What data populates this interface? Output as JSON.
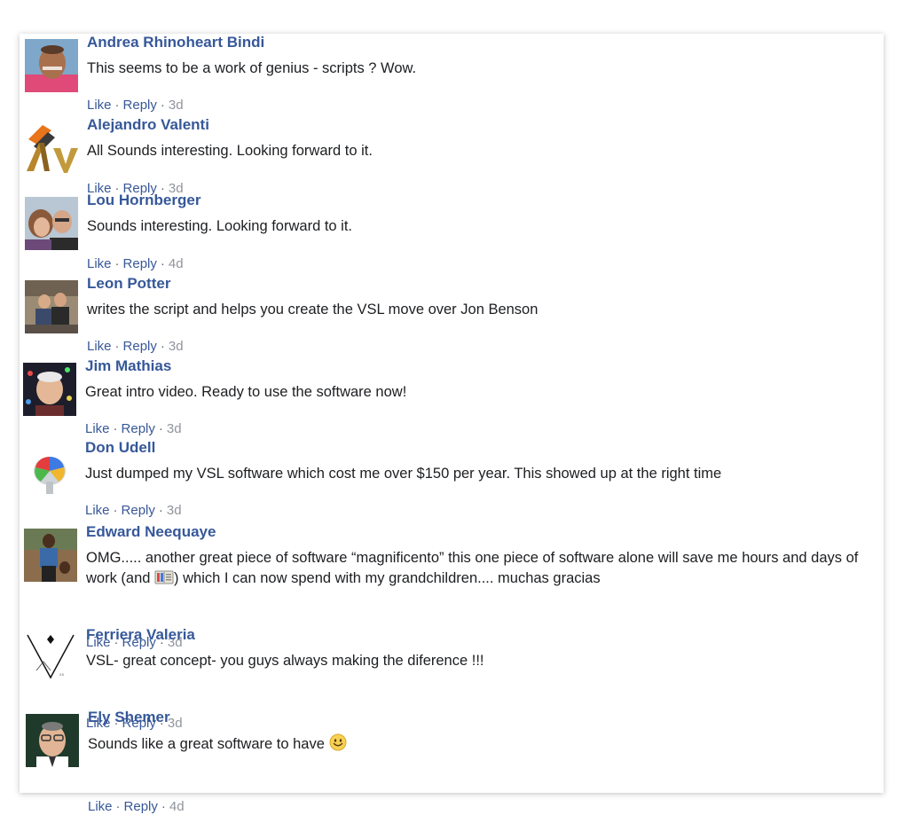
{
  "comments": [
    {
      "name": "Andrea Rhinoheart Bindi",
      "text": "This seems to be a work of genius - scripts ? Wow.",
      "like": "Like",
      "reply": "Reply",
      "time": "3d"
    },
    {
      "name": "Alejandro Valenti",
      "text": "All Sounds interesting. Looking forward to it.",
      "like": "Like",
      "reply": "Reply",
      "time": "3d"
    },
    {
      "name": "Lou Hornberger",
      "text": "Sounds interesting. Looking forward to it.",
      "like": "Like",
      "reply": "Reply",
      "time": "4d"
    },
    {
      "name": "Leon Potter",
      "text": "writes the script and helps you create the VSL move over Jon Benson",
      "like": "Like",
      "reply": "Reply",
      "time": "3d"
    },
    {
      "name": "Jim Mathias",
      "text": "Great intro video. Ready to use the software now!",
      "like": "Like",
      "reply": "Reply",
      "time": "3d"
    },
    {
      "name": "Don Udell",
      "text": "Just dumped my VSL software which cost me over $150 per year. This showed up at the right time",
      "like": "Like",
      "reply": "Reply",
      "time": "3d"
    },
    {
      "name": "Edward Neequaye",
      "text_before": "OMG..... another great piece of software “magnificento” this one piece of software alone will save me hours and days of work (and ",
      "text_after": ") which I can now spend with my grandchildren.... muchas gracias",
      "like": "Like",
      "reply": "Reply",
      "time": "3d"
    },
    {
      "name": "Ferriera Valeria",
      "text": "VSL- great concept- you guys always making the diference !!!",
      "like": "Like",
      "reply": "Reply",
      "time": "3d"
    },
    {
      "name": "Ely Shemer",
      "text": "Sounds like a great software to have ",
      "like": "Like",
      "reply": "Reply",
      "time": "4d"
    }
  ],
  "colors": {
    "name": "#365899",
    "link": "#385898",
    "text": "#1c1e21",
    "meta": "#90949c"
  }
}
